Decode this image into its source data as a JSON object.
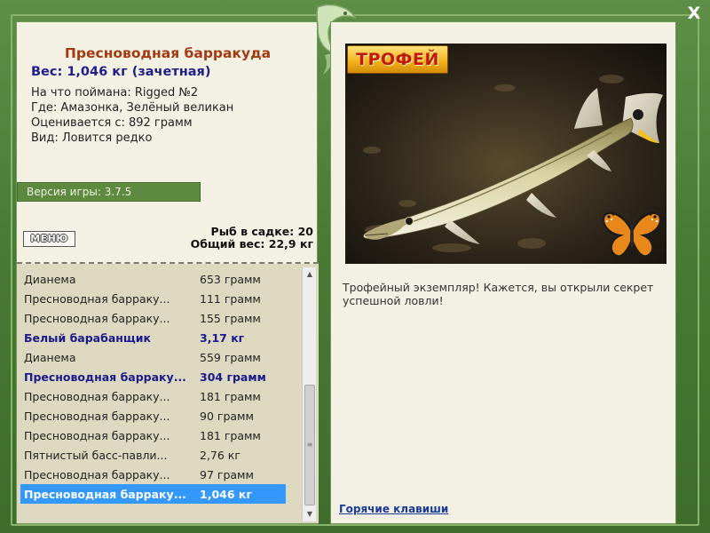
{
  "window": {
    "close_icon": "close-icon",
    "close_glyph": "X"
  },
  "fish": {
    "title": "Пресноводная барракуда",
    "weight_line": "Вес: 1,046 кг (зачетная)",
    "bait": "На что поймана: Rigged №2",
    "location": "Где: Амазонка, Зелёный великан",
    "rated_from": "Оценивается с: 892 грамм",
    "species": "Вид: Ловится редко"
  },
  "version": {
    "label": "Версия игры: 3.7.5"
  },
  "menu": {
    "label": "МЕНЮ"
  },
  "keepnet": {
    "count_line": "Рыб в садке: 20",
    "total_line": "Общий вес: 22,9 кг"
  },
  "catch_list": [
    {
      "name": "Дианема",
      "weight": "653 грамм",
      "trophy": false,
      "selected": false
    },
    {
      "name": "Пресноводная барраку...",
      "weight": "111 грамм",
      "trophy": false,
      "selected": false
    },
    {
      "name": "Пресноводная барраку...",
      "weight": "155 грамм",
      "trophy": false,
      "selected": false
    },
    {
      "name": "Белый барабанщик",
      "weight": "3,17 кг",
      "trophy": true,
      "selected": false
    },
    {
      "name": "Дианема",
      "weight": "559 грамм",
      "trophy": false,
      "selected": false
    },
    {
      "name": "Пресноводная барраку...",
      "weight": "304 грамм",
      "trophy": true,
      "selected": false
    },
    {
      "name": "Пресноводная барраку...",
      "weight": "181 грамм",
      "trophy": false,
      "selected": false
    },
    {
      "name": "Пресноводная барраку...",
      "weight": "90 грамм",
      "trophy": false,
      "selected": false
    },
    {
      "name": "Пресноводная барраку...",
      "weight": "181 грамм",
      "trophy": false,
      "selected": false
    },
    {
      "name": "Пятнистый басс-павли...",
      "weight": "2,76 кг",
      "trophy": false,
      "selected": false
    },
    {
      "name": "Пресноводная барраку...",
      "weight": "97 грамм",
      "trophy": false,
      "selected": false
    },
    {
      "name": "Пресноводная барраку...",
      "weight": "1,046 кг",
      "trophy": true,
      "selected": true
    }
  ],
  "scrollbar": {
    "up_icon": "scroll-up-arrow-icon",
    "down_icon": "scroll-down-arrow-icon",
    "up_glyph": "▲",
    "down_glyph": "▼",
    "grip_glyph": "≡"
  },
  "photo": {
    "badge": "ТРОФЕЙ",
    "subject_icon": "fish-photo",
    "decor_icon": "butterfly-icon"
  },
  "description": "Трофейный экземпляр! Кажется, вы открыли секрет успешной ловли!",
  "hotkeys": {
    "label": "Горячие клавиши"
  },
  "colors": {
    "frame_green": "#4a7a3a",
    "panel_bg": "#f3f1e4",
    "list_bg": "#dcd9c0",
    "title_red": "#a33a12",
    "weight_blue": "#1f1f8c",
    "trophy_blue": "#1a1a8c",
    "selected_bg": "#3399ff",
    "link_blue": "#1a3a9a"
  }
}
